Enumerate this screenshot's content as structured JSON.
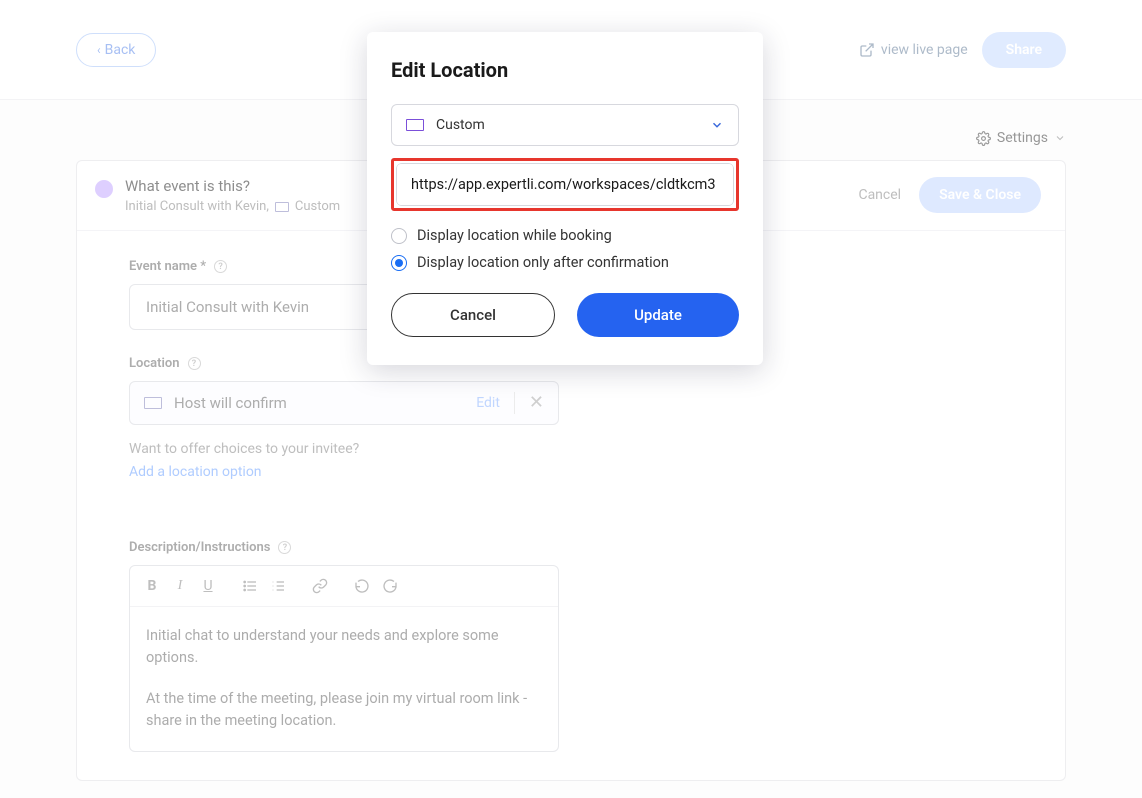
{
  "header": {
    "back_label": "Back",
    "live_page_label": "view live page",
    "share_label": "Share"
  },
  "settings_label": "Settings",
  "card": {
    "what_event_title": "What event is this?",
    "subtitle_prefix": "Initial Consult with Kevin,",
    "subtitle_custom": "Custom",
    "cancel_label": "Cancel",
    "save_close_label": "Save & Close"
  },
  "form": {
    "event_name_label": "Event name *",
    "event_name_value": "Initial Consult with Kevin",
    "location_label": "Location",
    "location_text": "Host will confirm",
    "edit_label": "Edit",
    "offer_hint": "Want to offer choices to your invitee?",
    "add_location_label": "Add a location option",
    "description_label": "Description/Instructions",
    "desc_p1": "Initial chat to understand your needs and explore some options.",
    "desc_p2": "At the time of the meeting, please join my virtual room link - share in the meeting location."
  },
  "modal": {
    "title": "Edit Location",
    "select_label": "Custom",
    "url_value": "https://app.expertli.com/workspaces/cldtkcm3",
    "radio_while_booking": "Display location while booking",
    "radio_after_confirmation": "Display location only after confirmation",
    "selected_radio": "after",
    "cancel_label": "Cancel",
    "update_label": "Update"
  }
}
